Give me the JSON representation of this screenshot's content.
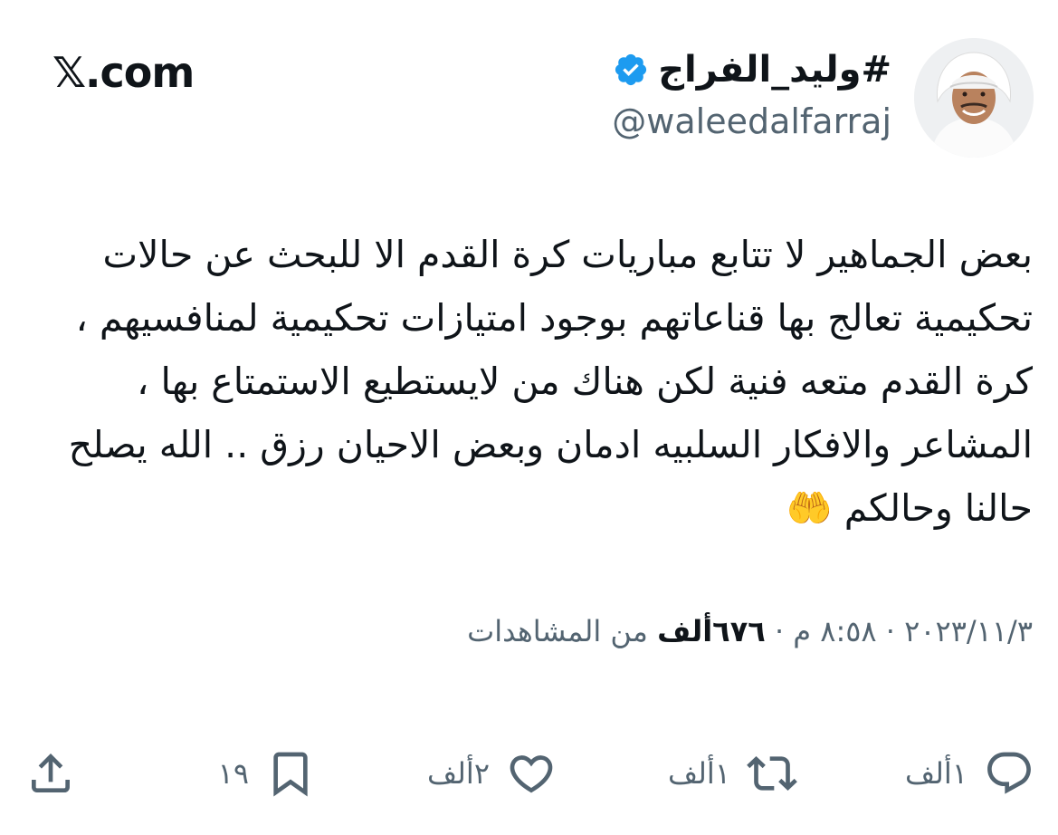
{
  "brand": "𝕏.com",
  "author": {
    "display_name": "#وليد_الفراج",
    "handle": "@waleedalfarraj",
    "verified": true
  },
  "tweet": {
    "text": "بعض الجماهير لا تتابع مباريات كرة القدم الا للبحث عن حالات تحكيمية تعالج بها قناعاتهم بوجود امتيازات تحكيمية لمنافسيهم ، كرة القدم متعه فنية لكن هناك من لايستطيع الاستمتاع بها ، المشاعر والافكار السلبيه ادمان وبعض الاحيان رزق .. الله يصلح حالنا وحالكم 🤲"
  },
  "meta": {
    "date": "٢٠٢٣/١١/٣",
    "separator": "·",
    "time": "٨:٥٨ م",
    "views_count": "٦٧٦ألف",
    "views_label": "من المشاهدات"
  },
  "actions": {
    "replies": "١ألف",
    "retweets": "١ألف",
    "likes": "٢ألف",
    "bookmarks": "١٩"
  },
  "colors": {
    "text": "#0f1419",
    "secondary": "#536471",
    "verified": "#1d9bf0",
    "background": "#ffffff"
  },
  "icons": {
    "reply": "speech-bubble-icon",
    "retweet": "retweet-arrows-icon",
    "like": "heart-icon",
    "bookmark": "bookmark-icon",
    "share": "share-upload-icon"
  }
}
